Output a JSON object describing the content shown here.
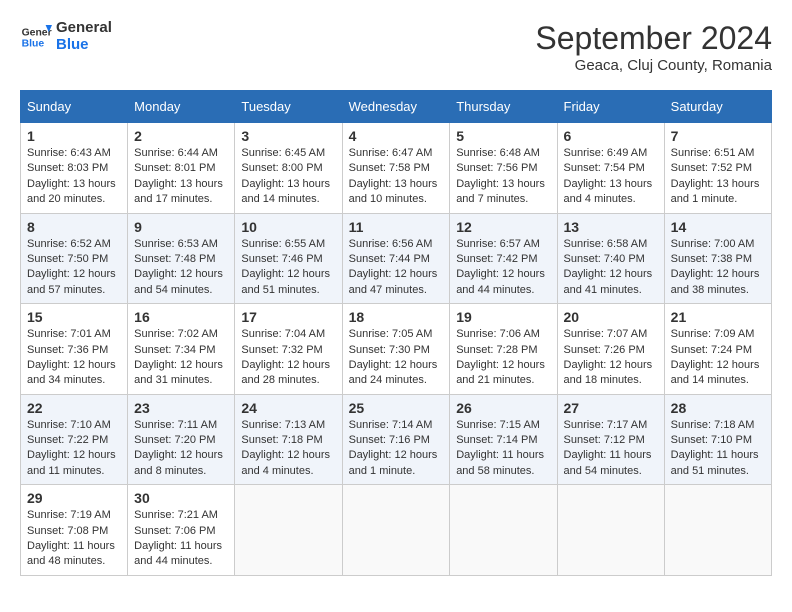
{
  "logo": {
    "line1": "General",
    "line2": "Blue"
  },
  "title": "September 2024",
  "location": "Geaca, Cluj County, Romania",
  "days_of_week": [
    "Sunday",
    "Monday",
    "Tuesday",
    "Wednesday",
    "Thursday",
    "Friday",
    "Saturday"
  ],
  "weeks": [
    [
      {
        "day": "1",
        "sunrise": "6:43 AM",
        "sunset": "8:03 PM",
        "daylight": "13 hours and 20 minutes."
      },
      {
        "day": "2",
        "sunrise": "6:44 AM",
        "sunset": "8:01 PM",
        "daylight": "13 hours and 17 minutes."
      },
      {
        "day": "3",
        "sunrise": "6:45 AM",
        "sunset": "8:00 PM",
        "daylight": "13 hours and 14 minutes."
      },
      {
        "day": "4",
        "sunrise": "6:47 AM",
        "sunset": "7:58 PM",
        "daylight": "13 hours and 10 minutes."
      },
      {
        "day": "5",
        "sunrise": "6:48 AM",
        "sunset": "7:56 PM",
        "daylight": "13 hours and 7 minutes."
      },
      {
        "day": "6",
        "sunrise": "6:49 AM",
        "sunset": "7:54 PM",
        "daylight": "13 hours and 4 minutes."
      },
      {
        "day": "7",
        "sunrise": "6:51 AM",
        "sunset": "7:52 PM",
        "daylight": "13 hours and 1 minute."
      }
    ],
    [
      {
        "day": "8",
        "sunrise": "6:52 AM",
        "sunset": "7:50 PM",
        "daylight": "12 hours and 57 minutes."
      },
      {
        "day": "9",
        "sunrise": "6:53 AM",
        "sunset": "7:48 PM",
        "daylight": "12 hours and 54 minutes."
      },
      {
        "day": "10",
        "sunrise": "6:55 AM",
        "sunset": "7:46 PM",
        "daylight": "12 hours and 51 minutes."
      },
      {
        "day": "11",
        "sunrise": "6:56 AM",
        "sunset": "7:44 PM",
        "daylight": "12 hours and 47 minutes."
      },
      {
        "day": "12",
        "sunrise": "6:57 AM",
        "sunset": "7:42 PM",
        "daylight": "12 hours and 44 minutes."
      },
      {
        "day": "13",
        "sunrise": "6:58 AM",
        "sunset": "7:40 PM",
        "daylight": "12 hours and 41 minutes."
      },
      {
        "day": "14",
        "sunrise": "7:00 AM",
        "sunset": "7:38 PM",
        "daylight": "12 hours and 38 minutes."
      }
    ],
    [
      {
        "day": "15",
        "sunrise": "7:01 AM",
        "sunset": "7:36 PM",
        "daylight": "12 hours and 34 minutes."
      },
      {
        "day": "16",
        "sunrise": "7:02 AM",
        "sunset": "7:34 PM",
        "daylight": "12 hours and 31 minutes."
      },
      {
        "day": "17",
        "sunrise": "7:04 AM",
        "sunset": "7:32 PM",
        "daylight": "12 hours and 28 minutes."
      },
      {
        "day": "18",
        "sunrise": "7:05 AM",
        "sunset": "7:30 PM",
        "daylight": "12 hours and 24 minutes."
      },
      {
        "day": "19",
        "sunrise": "7:06 AM",
        "sunset": "7:28 PM",
        "daylight": "12 hours and 21 minutes."
      },
      {
        "day": "20",
        "sunrise": "7:07 AM",
        "sunset": "7:26 PM",
        "daylight": "12 hours and 18 minutes."
      },
      {
        "day": "21",
        "sunrise": "7:09 AM",
        "sunset": "7:24 PM",
        "daylight": "12 hours and 14 minutes."
      }
    ],
    [
      {
        "day": "22",
        "sunrise": "7:10 AM",
        "sunset": "7:22 PM",
        "daylight": "12 hours and 11 minutes."
      },
      {
        "day": "23",
        "sunrise": "7:11 AM",
        "sunset": "7:20 PM",
        "daylight": "12 hours and 8 minutes."
      },
      {
        "day": "24",
        "sunrise": "7:13 AM",
        "sunset": "7:18 PM",
        "daylight": "12 hours and 4 minutes."
      },
      {
        "day": "25",
        "sunrise": "7:14 AM",
        "sunset": "7:16 PM",
        "daylight": "12 hours and 1 minute."
      },
      {
        "day": "26",
        "sunrise": "7:15 AM",
        "sunset": "7:14 PM",
        "daylight": "11 hours and 58 minutes."
      },
      {
        "day": "27",
        "sunrise": "7:17 AM",
        "sunset": "7:12 PM",
        "daylight": "11 hours and 54 minutes."
      },
      {
        "day": "28",
        "sunrise": "7:18 AM",
        "sunset": "7:10 PM",
        "daylight": "11 hours and 51 minutes."
      }
    ],
    [
      {
        "day": "29",
        "sunrise": "7:19 AM",
        "sunset": "7:08 PM",
        "daylight": "11 hours and 48 minutes."
      },
      {
        "day": "30",
        "sunrise": "7:21 AM",
        "sunset": "7:06 PM",
        "daylight": "11 hours and 44 minutes."
      },
      null,
      null,
      null,
      null,
      null
    ]
  ]
}
